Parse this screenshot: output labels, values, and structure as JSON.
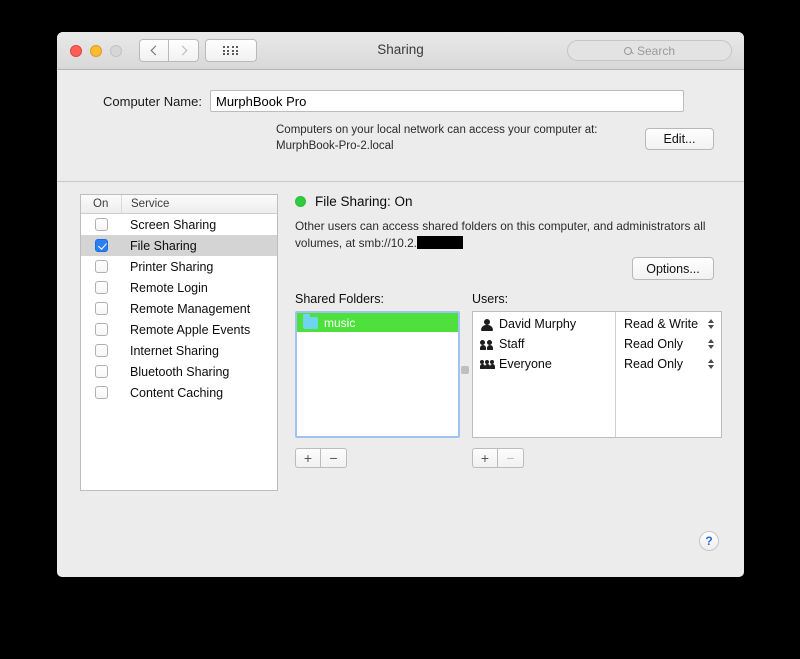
{
  "window": {
    "title": "Sharing",
    "search_placeholder": "Search"
  },
  "computer_name": {
    "label": "Computer Name:",
    "value": "MurphBook Pro",
    "info_line1": "Computers on your local network can access your computer at:",
    "info_line2": "MurphBook-Pro-2.local",
    "edit_label": "Edit..."
  },
  "service_table": {
    "header_on": "On",
    "header_service": "Service",
    "rows": [
      {
        "label": "Screen Sharing",
        "checked": false,
        "selected": false
      },
      {
        "label": "File Sharing",
        "checked": true,
        "selected": true
      },
      {
        "label": "Printer Sharing",
        "checked": false,
        "selected": false
      },
      {
        "label": "Remote Login",
        "checked": false,
        "selected": false
      },
      {
        "label": "Remote Management",
        "checked": false,
        "selected": false
      },
      {
        "label": "Remote Apple Events",
        "checked": false,
        "selected": false
      },
      {
        "label": "Internet Sharing",
        "checked": false,
        "selected": false
      },
      {
        "label": "Bluetooth Sharing",
        "checked": false,
        "selected": false
      },
      {
        "label": "Content Caching",
        "checked": false,
        "selected": false
      }
    ]
  },
  "detail": {
    "status": "File Sharing: On",
    "status_color": "#2fcc3f",
    "description_before": "Other users can access shared folders on this computer, and administrators all volumes, at smb://10.2.",
    "options_label": "Options...",
    "shared_folders_label": "Shared Folders:",
    "users_label": "Users:",
    "shared_folders": [
      {
        "name": "music",
        "highlight": "#4ee03c"
      }
    ],
    "users": [
      {
        "name": "David Murphy",
        "icon": "person-icon",
        "permission": "Read & Write"
      },
      {
        "name": "Staff",
        "icon": "two-people-icon",
        "permission": "Read Only"
      },
      {
        "name": "Everyone",
        "icon": "three-people-icon",
        "permission": "Read Only"
      }
    ],
    "add_label": "+",
    "remove_label": "−"
  },
  "help": {
    "label": "?"
  }
}
